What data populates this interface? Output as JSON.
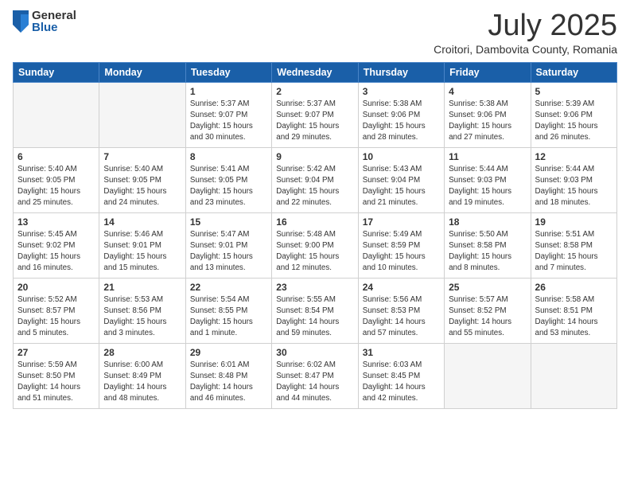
{
  "logo": {
    "general": "General",
    "blue": "Blue"
  },
  "title": "July 2025",
  "subtitle": "Croitori, Dambovita County, Romania",
  "headers": [
    "Sunday",
    "Monday",
    "Tuesday",
    "Wednesday",
    "Thursday",
    "Friday",
    "Saturday"
  ],
  "weeks": [
    [
      {
        "day": "",
        "info": ""
      },
      {
        "day": "",
        "info": ""
      },
      {
        "day": "1",
        "info": "Sunrise: 5:37 AM\nSunset: 9:07 PM\nDaylight: 15 hours and 30 minutes."
      },
      {
        "day": "2",
        "info": "Sunrise: 5:37 AM\nSunset: 9:07 PM\nDaylight: 15 hours and 29 minutes."
      },
      {
        "day": "3",
        "info": "Sunrise: 5:38 AM\nSunset: 9:06 PM\nDaylight: 15 hours and 28 minutes."
      },
      {
        "day": "4",
        "info": "Sunrise: 5:38 AM\nSunset: 9:06 PM\nDaylight: 15 hours and 27 minutes."
      },
      {
        "day": "5",
        "info": "Sunrise: 5:39 AM\nSunset: 9:06 PM\nDaylight: 15 hours and 26 minutes."
      }
    ],
    [
      {
        "day": "6",
        "info": "Sunrise: 5:40 AM\nSunset: 9:05 PM\nDaylight: 15 hours and 25 minutes."
      },
      {
        "day": "7",
        "info": "Sunrise: 5:40 AM\nSunset: 9:05 PM\nDaylight: 15 hours and 24 minutes."
      },
      {
        "day": "8",
        "info": "Sunrise: 5:41 AM\nSunset: 9:05 PM\nDaylight: 15 hours and 23 minutes."
      },
      {
        "day": "9",
        "info": "Sunrise: 5:42 AM\nSunset: 9:04 PM\nDaylight: 15 hours and 22 minutes."
      },
      {
        "day": "10",
        "info": "Sunrise: 5:43 AM\nSunset: 9:04 PM\nDaylight: 15 hours and 21 minutes."
      },
      {
        "day": "11",
        "info": "Sunrise: 5:44 AM\nSunset: 9:03 PM\nDaylight: 15 hours and 19 minutes."
      },
      {
        "day": "12",
        "info": "Sunrise: 5:44 AM\nSunset: 9:03 PM\nDaylight: 15 hours and 18 minutes."
      }
    ],
    [
      {
        "day": "13",
        "info": "Sunrise: 5:45 AM\nSunset: 9:02 PM\nDaylight: 15 hours and 16 minutes."
      },
      {
        "day": "14",
        "info": "Sunrise: 5:46 AM\nSunset: 9:01 PM\nDaylight: 15 hours and 15 minutes."
      },
      {
        "day": "15",
        "info": "Sunrise: 5:47 AM\nSunset: 9:01 PM\nDaylight: 15 hours and 13 minutes."
      },
      {
        "day": "16",
        "info": "Sunrise: 5:48 AM\nSunset: 9:00 PM\nDaylight: 15 hours and 12 minutes."
      },
      {
        "day": "17",
        "info": "Sunrise: 5:49 AM\nSunset: 8:59 PM\nDaylight: 15 hours and 10 minutes."
      },
      {
        "day": "18",
        "info": "Sunrise: 5:50 AM\nSunset: 8:58 PM\nDaylight: 15 hours and 8 minutes."
      },
      {
        "day": "19",
        "info": "Sunrise: 5:51 AM\nSunset: 8:58 PM\nDaylight: 15 hours and 7 minutes."
      }
    ],
    [
      {
        "day": "20",
        "info": "Sunrise: 5:52 AM\nSunset: 8:57 PM\nDaylight: 15 hours and 5 minutes."
      },
      {
        "day": "21",
        "info": "Sunrise: 5:53 AM\nSunset: 8:56 PM\nDaylight: 15 hours and 3 minutes."
      },
      {
        "day": "22",
        "info": "Sunrise: 5:54 AM\nSunset: 8:55 PM\nDaylight: 15 hours and 1 minute."
      },
      {
        "day": "23",
        "info": "Sunrise: 5:55 AM\nSunset: 8:54 PM\nDaylight: 14 hours and 59 minutes."
      },
      {
        "day": "24",
        "info": "Sunrise: 5:56 AM\nSunset: 8:53 PM\nDaylight: 14 hours and 57 minutes."
      },
      {
        "day": "25",
        "info": "Sunrise: 5:57 AM\nSunset: 8:52 PM\nDaylight: 14 hours and 55 minutes."
      },
      {
        "day": "26",
        "info": "Sunrise: 5:58 AM\nSunset: 8:51 PM\nDaylight: 14 hours and 53 minutes."
      }
    ],
    [
      {
        "day": "27",
        "info": "Sunrise: 5:59 AM\nSunset: 8:50 PM\nDaylight: 14 hours and 51 minutes."
      },
      {
        "day": "28",
        "info": "Sunrise: 6:00 AM\nSunset: 8:49 PM\nDaylight: 14 hours and 48 minutes."
      },
      {
        "day": "29",
        "info": "Sunrise: 6:01 AM\nSunset: 8:48 PM\nDaylight: 14 hours and 46 minutes."
      },
      {
        "day": "30",
        "info": "Sunrise: 6:02 AM\nSunset: 8:47 PM\nDaylight: 14 hours and 44 minutes."
      },
      {
        "day": "31",
        "info": "Sunrise: 6:03 AM\nSunset: 8:45 PM\nDaylight: 14 hours and 42 minutes."
      },
      {
        "day": "",
        "info": ""
      },
      {
        "day": "",
        "info": ""
      }
    ]
  ]
}
